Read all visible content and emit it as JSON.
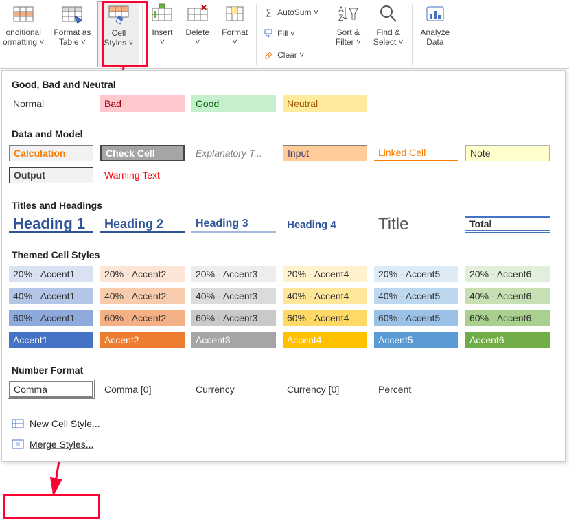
{
  "ribbon": {
    "conditional": "onditional\normatting ˅",
    "formatAs": "Format as\nTable ˅",
    "cellStyles": "Cell\nStyles ˅",
    "insert": "Insert\n˅",
    "delete": "Delete\n˅",
    "format": "Format\n˅",
    "autosum": "AutoSum ˅",
    "fill": "Fill ˅",
    "clear": "Clear ˅",
    "sortFilter": "Sort &\nFilter ˅",
    "findSelect": "Find &\nSelect ˅",
    "analyze": "Analyze\nData"
  },
  "sections": {
    "goodBadNeutral": "Good, Bad and Neutral",
    "dataModel": "Data and Model",
    "titlesHeadings": "Titles and Headings",
    "themed": "Themed Cell Styles",
    "numberFormat": "Number Format"
  },
  "styles": {
    "goodBadNeutral": [
      {
        "label": "Normal",
        "bg": "#ffffff",
        "color": "#333",
        "border": "none"
      },
      {
        "label": "Bad",
        "bg": "#FFC7CE",
        "color": "#9C0006",
        "border": "none"
      },
      {
        "label": "Good",
        "bg": "#C6EFCE",
        "color": "#006100",
        "border": "none"
      },
      {
        "label": "Neutral",
        "bg": "#FFEB9C",
        "color": "#9C5700",
        "border": "none"
      }
    ],
    "dataModel": [
      {
        "label": "Calculation",
        "bg": "#F2F2F2",
        "color": "#FA7D00",
        "border": "1px solid #7F7F7F",
        "bold": true
      },
      {
        "label": "Check Cell",
        "bg": "#A5A5A5",
        "color": "#FFFFFF",
        "border": "2px double #444",
        "bold": true
      },
      {
        "label": "Explanatory T...",
        "bg": "#fff",
        "color": "#7F7F7F",
        "border": "none",
        "italic": true
      },
      {
        "label": "Input",
        "bg": "#FFCC99",
        "color": "#3F3F76",
        "border": "1px solid #7F7F7F"
      },
      {
        "label": "Linked Cell",
        "bg": "#fff",
        "color": "#FA7D00",
        "border": "none",
        "underline": "2px solid #FA7D00"
      },
      {
        "label": "Note",
        "bg": "#FFFFCC",
        "color": "#333",
        "border": "1px solid #B2B2B2"
      },
      {
        "label": "Output",
        "bg": "#F2F2F2",
        "color": "#3F3F3F",
        "border": "1px solid #3F3F3F",
        "bold": true
      },
      {
        "label": "Warning Text",
        "bg": "#fff",
        "color": "#FF0000",
        "border": "none"
      }
    ],
    "titlesHeadings": [
      {
        "label": "Heading 1",
        "class": "h1"
      },
      {
        "label": "Heading 2",
        "class": "h2"
      },
      {
        "label": "Heading 3",
        "class": "h3"
      },
      {
        "label": "Heading 4",
        "class": "h4"
      },
      {
        "label": "Title",
        "class": "title"
      },
      {
        "label": "Total",
        "class": "total"
      }
    ],
    "themed": [
      {
        "label": "20% - Accent1",
        "bg": "#D9E1F2"
      },
      {
        "label": "20% - Accent2",
        "bg": "#FCE4D6"
      },
      {
        "label": "20% - Accent3",
        "bg": "#EDEDED"
      },
      {
        "label": "20% - Accent4",
        "bg": "#FFF2CC"
      },
      {
        "label": "20% - Accent5",
        "bg": "#DDEBF7"
      },
      {
        "label": "20% - Accent6",
        "bg": "#E2EFDA"
      },
      {
        "label": "40% - Accent1",
        "bg": "#B4C6E7"
      },
      {
        "label": "40% - Accent2",
        "bg": "#F8CBAD"
      },
      {
        "label": "40% - Accent3",
        "bg": "#DBDBDB"
      },
      {
        "label": "40% - Accent4",
        "bg": "#FFE699"
      },
      {
        "label": "40% - Accent5",
        "bg": "#BDD7EE"
      },
      {
        "label": "40% - Accent6",
        "bg": "#C6E0B4"
      },
      {
        "label": "60% - Accent1",
        "bg": "#8EA9DB"
      },
      {
        "label": "60% - Accent2",
        "bg": "#F4B084"
      },
      {
        "label": "60% - Accent3",
        "bg": "#C9C9C9"
      },
      {
        "label": "60% - Accent4",
        "bg": "#FFD966"
      },
      {
        "label": "60% - Accent5",
        "bg": "#9BC2E6"
      },
      {
        "label": "60% - Accent6",
        "bg": "#A9D08E"
      },
      {
        "label": "Accent1",
        "bg": "#4472C4",
        "color": "#fff"
      },
      {
        "label": "Accent2",
        "bg": "#ED7D31",
        "color": "#fff"
      },
      {
        "label": "Accent3",
        "bg": "#A5A5A5",
        "color": "#fff"
      },
      {
        "label": "Accent4",
        "bg": "#FFC000",
        "color": "#fff"
      },
      {
        "label": "Accent5",
        "bg": "#5B9BD5",
        "color": "#fff"
      },
      {
        "label": "Accent6",
        "bg": "#70AD47",
        "color": "#fff"
      }
    ],
    "numberFormat": [
      {
        "label": "Comma",
        "bg": "#fff",
        "border": "1px solid #7F7F7F",
        "boxed": true
      },
      {
        "label": "Comma [0]",
        "bg": "#fff"
      },
      {
        "label": "Currency",
        "bg": "#fff"
      },
      {
        "label": "Currency [0]",
        "bg": "#fff"
      },
      {
        "label": "Percent",
        "bg": "#fff"
      }
    ]
  },
  "footer": {
    "newCellStyle": "New Cell Style...",
    "mergeStyles": "Merge Styles..."
  }
}
